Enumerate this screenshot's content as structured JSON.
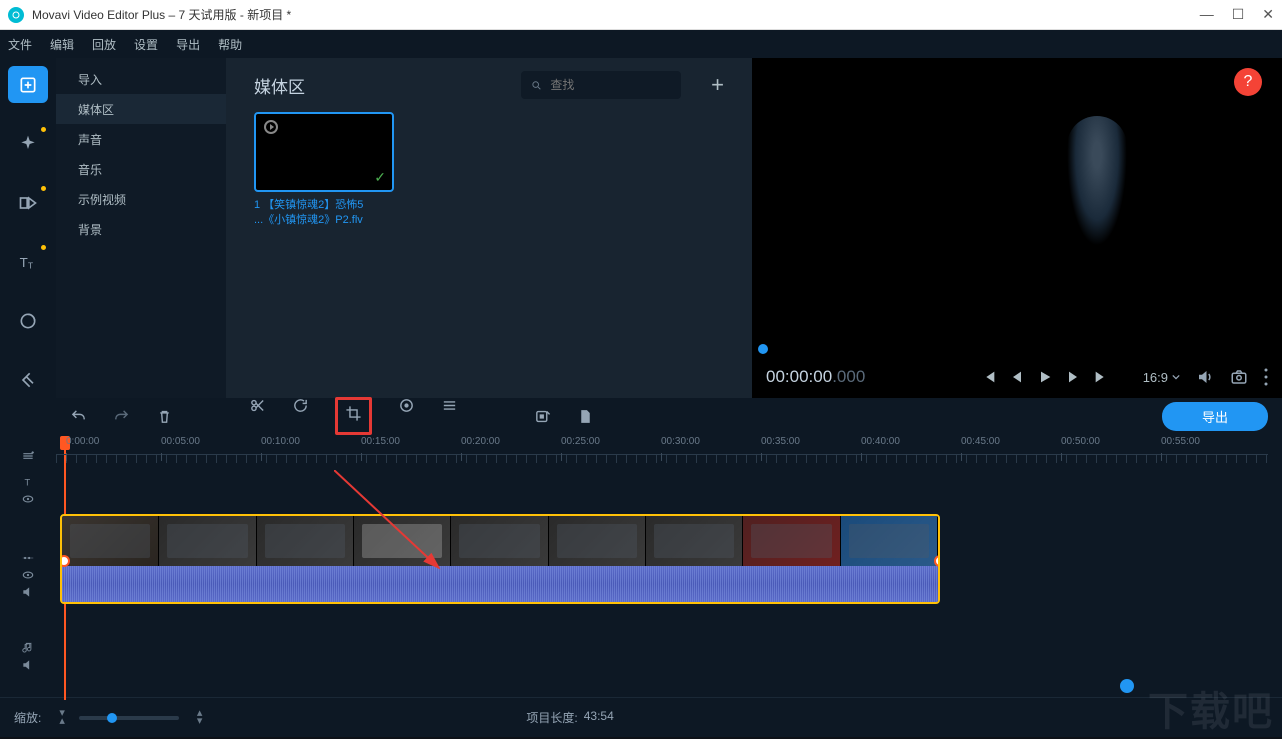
{
  "titlebar": {
    "title": "Movavi Video Editor Plus – 7 天试用版 - 新项目 *"
  },
  "menubar": {
    "file": "文件",
    "edit": "编辑",
    "play": "回放",
    "settings": "设置",
    "export": "导出",
    "help": "帮助"
  },
  "sidebar": {
    "import": "导入",
    "media": "媒体区",
    "sound": "声音",
    "music": "音乐",
    "sample": "示例视频",
    "bg": "背景"
  },
  "media": {
    "title": "媒体区",
    "search_placeholder": "查找",
    "item_line1": "1 【笑镇惊魂2】恐怖5",
    "item_line2": "...《小镇惊魂2》P2.flv"
  },
  "preview": {
    "time_main": "00:00:00",
    "time_ms": ".000",
    "aspect": "16:9"
  },
  "toolbar": {
    "export_btn": "导出"
  },
  "ruler": {
    "t0": "0:00:00",
    "t1": "00:05:00",
    "t2": "00:10:00",
    "t3": "00:15:00",
    "t4": "00:20:00",
    "t5": "00:25:00",
    "t6": "00:30:00",
    "t7": "00:35:00",
    "t8": "00:40:00",
    "t9": "00:45:00",
    "t10": "00:50:00",
    "t11": "00:55:00"
  },
  "bottom": {
    "zoom_label": "缩放:",
    "proj_len_label": "项目长度:",
    "proj_len_value": "43:54"
  },
  "help": "?"
}
